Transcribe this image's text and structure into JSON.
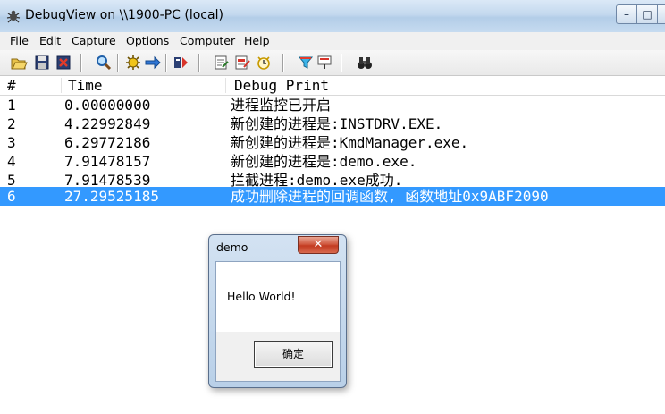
{
  "window": {
    "title": "DebugView on \\\\1900-PC (local)",
    "controls": {
      "minimize": "–",
      "maximize": "□",
      "close": "✕"
    }
  },
  "menu": [
    "File",
    "Edit",
    "Capture",
    "Options",
    "Computer",
    "Help"
  ],
  "toolbar": {
    "icons": [
      "open-icon",
      "save-icon",
      "clear-icon",
      "find-icon",
      "capture-icon",
      "autoscroll-icon",
      "clear-display-icon",
      "filter-icon",
      "highlight-icon",
      "log-icon",
      "clock-icon",
      "highlight-filter-icon",
      "properties-icon",
      "find-binoculars-icon"
    ]
  },
  "list": {
    "columns": [
      "#",
      "Time",
      "Debug Print"
    ],
    "rows": [
      {
        "num": "1",
        "time": "0.00000000",
        "message": "进程监控已开启"
      },
      {
        "num": "2",
        "time": "4.22992849",
        "message": "新创建的进程是:INSTDRV.EXE."
      },
      {
        "num": "3",
        "time": "6.29772186",
        "message": "新创建的进程是:KmdManager.exe."
      },
      {
        "num": "4",
        "time": "7.91478157",
        "message": "新创建的进程是:demo.exe."
      },
      {
        "num": "5",
        "time": "7.91478539",
        "message": "拦截进程:demo.exe成功."
      },
      {
        "num": "6",
        "time": "27.29525185",
        "message": "成功删除进程的回调函数, 函数地址0x9ABF2090"
      }
    ],
    "selected_row": "6",
    "colors": {
      "selection": "#3399ff"
    }
  },
  "dialog": {
    "title": "demo",
    "message": "Hello World!",
    "ok_label": "确定",
    "close_glyph": "✕"
  }
}
